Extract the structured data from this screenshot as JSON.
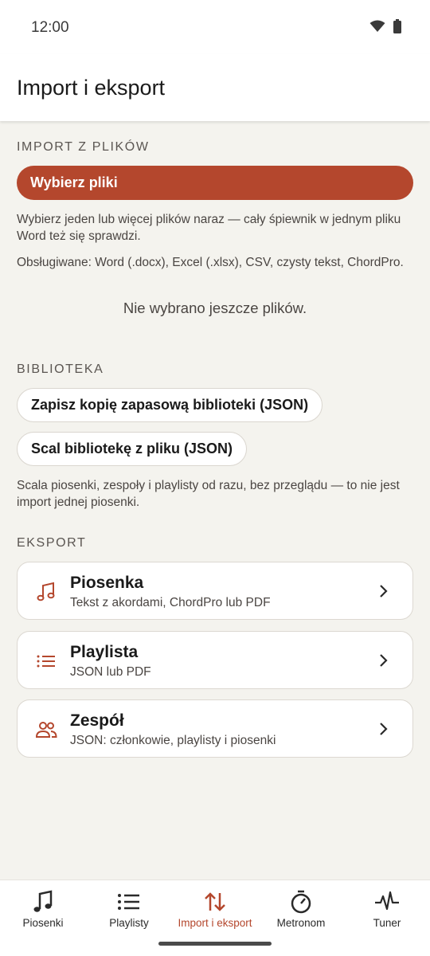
{
  "status_bar": {
    "time": "12:00"
  },
  "app_bar": {
    "title": "Import i eksport"
  },
  "import_section": {
    "label": "IMPORT Z PLIKÓW",
    "choose_files_label": "Wybierz pliki",
    "helper_text": "Wybierz jeden lub więcej plików naraz — cały śpiewnik w jednym pliku Word też się sprawdzi.",
    "supported_text": "Obsługiwane: Word (.docx), Excel (.xlsx), CSV, czysty tekst, ChordPro.",
    "empty_state": "Nie wybrano jeszcze plików."
  },
  "library_section": {
    "label": "BIBLIOTEKA",
    "backup_label": "Zapisz kopię zapasową biblioteki (JSON)",
    "merge_label": "Scal bibliotekę z pliku (JSON)",
    "helper_text": "Scala piosenki, zespoły i playlisty od razu, bez przeglądu — to nie jest import jednej piosenki."
  },
  "export_section": {
    "label": "EKSPORT",
    "items": [
      {
        "title": "Piosenka",
        "subtitle": "Tekst z akordami, ChordPro lub PDF",
        "icon": "music-note-icon"
      },
      {
        "title": "Playlista",
        "subtitle": "JSON lub PDF",
        "icon": "list-icon"
      },
      {
        "title": "Zespół",
        "subtitle": "JSON: członkowie, playlisty i piosenki",
        "icon": "group-icon"
      }
    ]
  },
  "bottom_nav": {
    "items": [
      {
        "label": "Piosenki",
        "icon": "music-note-icon"
      },
      {
        "label": "Playlisty",
        "icon": "list-icon"
      },
      {
        "label": "Import i eksport",
        "icon": "swap-arrows-icon",
        "active": true
      },
      {
        "label": "Metronom",
        "icon": "metronome-icon"
      },
      {
        "label": "Tuner",
        "icon": "waveform-icon"
      }
    ]
  },
  "colors": {
    "accent": "#b4472d",
    "background": "#f4f3ee",
    "surface": "#ffffff"
  }
}
